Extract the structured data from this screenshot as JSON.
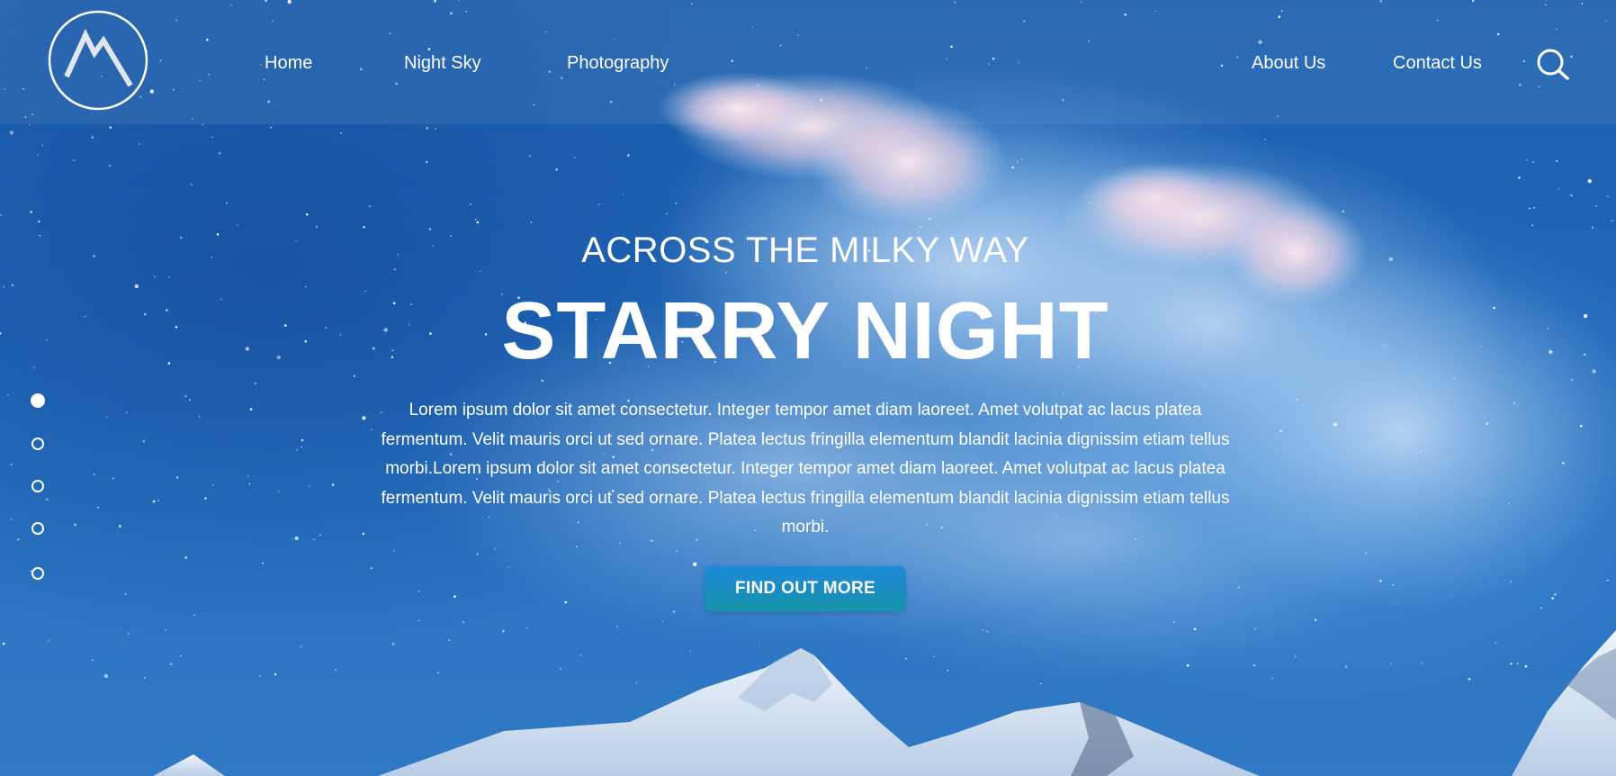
{
  "nav": {
    "left_links": [
      {
        "label": "Home"
      },
      {
        "label": "Night Sky"
      },
      {
        "label": "Photography"
      }
    ],
    "right_links": [
      {
        "label": "About Us"
      },
      {
        "label": "Contact Us"
      }
    ],
    "search_icon": "search-icon",
    "logo_icon": "mountain-logo-icon"
  },
  "hero": {
    "subtitle": "ACROSS THE MILKY WAY",
    "title": "STARRY NIGHT",
    "body": "Lorem ipsum dolor sit amet consectetur. Integer tempor amet diam laoreet. Amet volutpat ac lacus platea fermentum. Velit mauris orci ut sed ornare. Platea lectus fringilla elementum blandit lacinia dignissim etiam tellus morbi.Lorem ipsum dolor sit amet consectetur. Integer tempor amet diam laoreet. Amet volutpat ac lacus platea fermentum. Velit mauris orci ut sed ornare. Platea lectus fringilla elementum blandit lacinia dignissim etiam tellus morbi.",
    "cta_label": "FIND OUT MORE"
  },
  "slider": {
    "slide_count": 5,
    "active_index": 0
  },
  "colors": {
    "sky": "#1f5fae",
    "accent_button": "#1a8dbf",
    "text": "#ffffff"
  }
}
